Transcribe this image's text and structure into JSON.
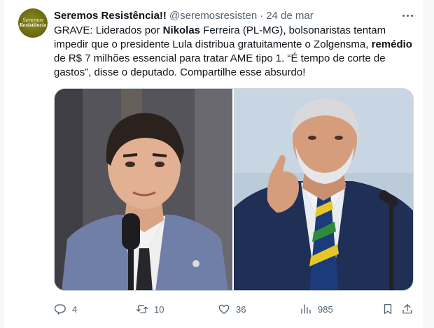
{
  "tweet": {
    "avatar_line1": "Seremos",
    "avatar_line2": "Resistência",
    "name": "Seremos Resistência!!",
    "handle": "@seremosresisten",
    "dot": "·",
    "date": "24 de mar",
    "text": {
      "p1": "GRAVE: Liderados por ",
      "b1": "Nikolas",
      "p2": " Ferreira (PL-MG), bolsonaristas tentam impedir que o presidente Lula distribua gratuitamente o Zolgensma, ",
      "b2": "remédio",
      "p3": " de R$ 7 milhões essencial para tratar AME tipo 1. “É tempo de corte de gastos”, disse o deputado. Compartilhe esse absurdo!"
    },
    "stats": {
      "replies": "4",
      "retweets": "10",
      "likes": "36",
      "views": "985"
    },
    "icons": {
      "more": "more-dots-icon",
      "reply": "reply-icon",
      "retweet": "retweet-icon",
      "like": "heart-icon",
      "views": "views-chart-icon",
      "bookmark": "bookmark-icon",
      "share": "share-icon"
    },
    "colors": {
      "text": "#0f1419",
      "secondary": "#536471",
      "border": "#cfd9de",
      "avatar_bg": "#6d6d12"
    }
  }
}
